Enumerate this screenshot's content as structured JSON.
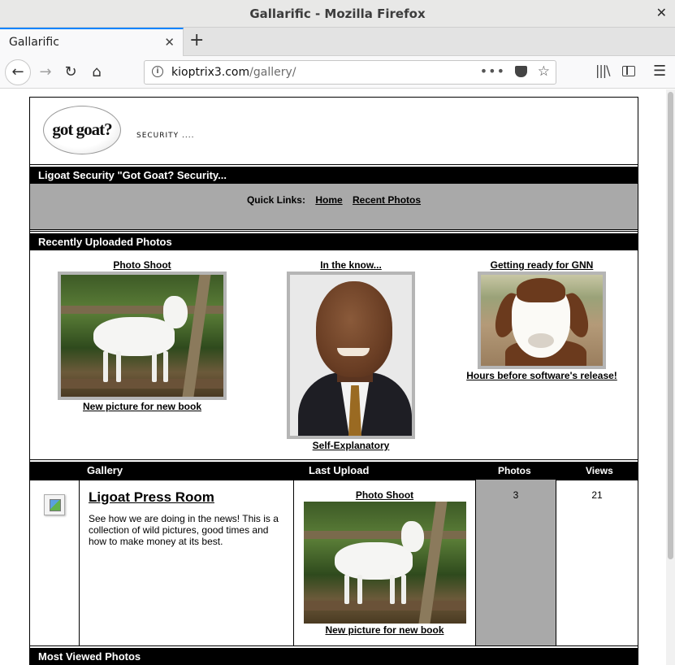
{
  "window": {
    "title": "Gallarific - Mozilla Firefox"
  },
  "tab": {
    "title": "Gallarific"
  },
  "address": {
    "host": "kioptrix3.com",
    "path": "/gallery/"
  },
  "site": {
    "logo_text": "got goat?",
    "tagline": "SECURITY ....",
    "banner": "Ligoat Security \"Got Goat? Security...",
    "quick_links_label": "Quick Links:",
    "quick_links": [
      "Home",
      "Recent Photos"
    ]
  },
  "recent": {
    "heading": "Recently Uploaded Photos",
    "photos": [
      {
        "title": "Photo Shoot",
        "caption": "New picture for new book"
      },
      {
        "title": "In the know...",
        "caption": "Self-Explanatory"
      },
      {
        "title": "Getting ready for GNN",
        "caption": "Hours before software's release!"
      }
    ]
  },
  "gallery_table": {
    "headers": {
      "gallery": "Gallery",
      "last_upload": "Last Upload",
      "photos": "Photos",
      "views": "Views"
    },
    "rows": [
      {
        "name": "Ligoat Press Room",
        "description": "See how we are doing in the news! This is a collection of wild pictures, good times and how to make money at its best.",
        "last_upload_title": "Photo Shoot",
        "last_upload_caption": "New picture for new book",
        "photos": "3",
        "views": "21"
      }
    ]
  },
  "most_viewed": {
    "heading": "Most Viewed Photos"
  },
  "colors": {
    "accent_tab": "#0a84ff",
    "bar": "#000000",
    "quicklinks_bg": "#a9a9a9"
  }
}
